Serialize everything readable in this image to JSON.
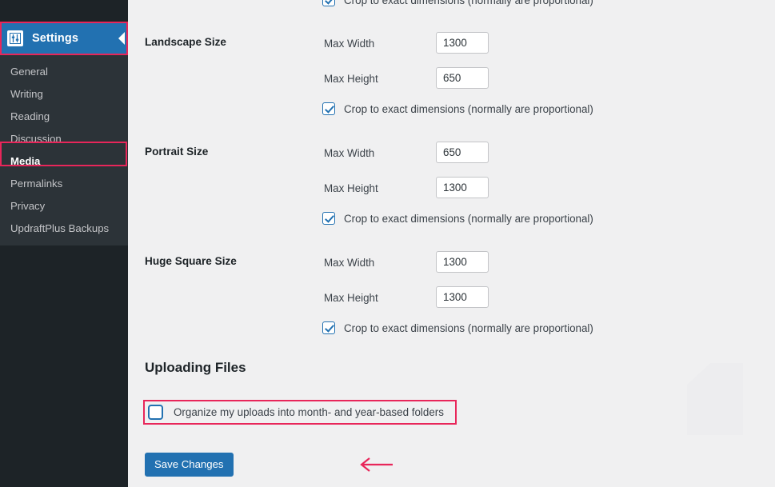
{
  "colors": {
    "sidebar_bg": "#1d2327",
    "submenu_bg": "#2c3338",
    "accent_blue": "#2271b1",
    "annotation_pink": "#e8265a",
    "content_bg": "#f0f0f1"
  },
  "sidebar": {
    "menu_top": {
      "label": "Settings",
      "icon": "settings-sliders-icon",
      "collapse_icon": "collapse-left-arrow-icon"
    },
    "items": [
      {
        "label": "General",
        "current": false
      },
      {
        "label": "Writing",
        "current": false
      },
      {
        "label": "Reading",
        "current": false
      },
      {
        "label": "Discussion",
        "current": false
      },
      {
        "label": "Media",
        "current": true
      },
      {
        "label": "Permalinks",
        "current": false
      },
      {
        "label": "Privacy",
        "current": false
      },
      {
        "label": "UpdraftPlus Backups",
        "current": false
      }
    ]
  },
  "main": {
    "crop_label": "Crop to exact dimensions (normally are proportional)",
    "partial_top_row": {
      "crop_label": "Crop to exact dimensions (normally are proportional)",
      "crop_checked": true
    },
    "image_sizes": [
      {
        "name": "Landscape Size",
        "width_label": "Max Width",
        "width_value": "1300",
        "height_label": "Max Height",
        "height_value": "650",
        "crop_checked": true
      },
      {
        "name": "Portrait Size",
        "width_label": "Max Width",
        "width_value": "650",
        "height_label": "Max Height",
        "height_value": "1300",
        "crop_checked": true
      },
      {
        "name": "Huge Square Size",
        "width_label": "Max Width",
        "width_value": "1300",
        "height_label": "Max Height",
        "height_value": "1300",
        "crop_checked": true
      }
    ],
    "uploading_files": {
      "heading": "Uploading Files",
      "organize_label": "Organize my uploads into month- and year-based folders",
      "organize_checked": false
    },
    "save_label": "Save Changes"
  }
}
